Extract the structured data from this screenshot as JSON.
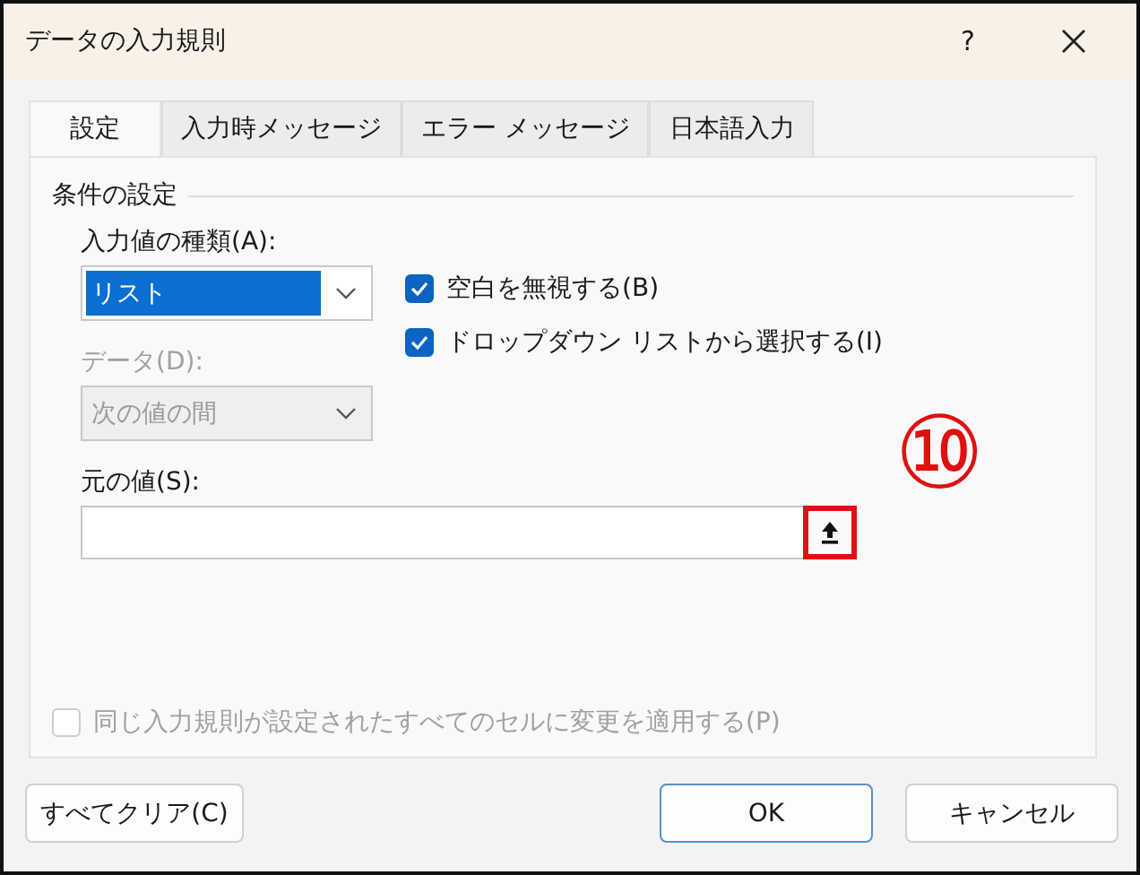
{
  "window": {
    "title": "データの入力規則",
    "help": "?"
  },
  "tabs": [
    {
      "label": "設定",
      "selected": true
    },
    {
      "label": "入力時メッセージ",
      "selected": false
    },
    {
      "label": "エラー メッセージ",
      "selected": false
    },
    {
      "label": "日本語入力",
      "selected": false
    }
  ],
  "group": {
    "title": "条件の設定"
  },
  "allow": {
    "label": "入力値の種類(A):",
    "value": "リスト",
    "disabled": false
  },
  "data": {
    "label": "データ(D):",
    "value": "次の値の間",
    "disabled": true
  },
  "checkboxes": [
    {
      "label": "空白を無視する(B)",
      "checked": true
    },
    {
      "label": "ドロップダウン リストから選択する(I)",
      "checked": true
    }
  ],
  "source": {
    "label": "元の値(S):"
  },
  "annotation": {
    "text": "⑩"
  },
  "apply_all": {
    "label": "同じ入力規則が設定されたすべてのセルに変更を適用する(P)",
    "checked": false,
    "disabled": true
  },
  "buttons": [
    {
      "label": "すべてクリア(C)",
      "kind": "left"
    },
    {
      "label": "OK",
      "kind": "default"
    },
    {
      "label": "キャンセル",
      "kind": "normal"
    }
  ]
}
